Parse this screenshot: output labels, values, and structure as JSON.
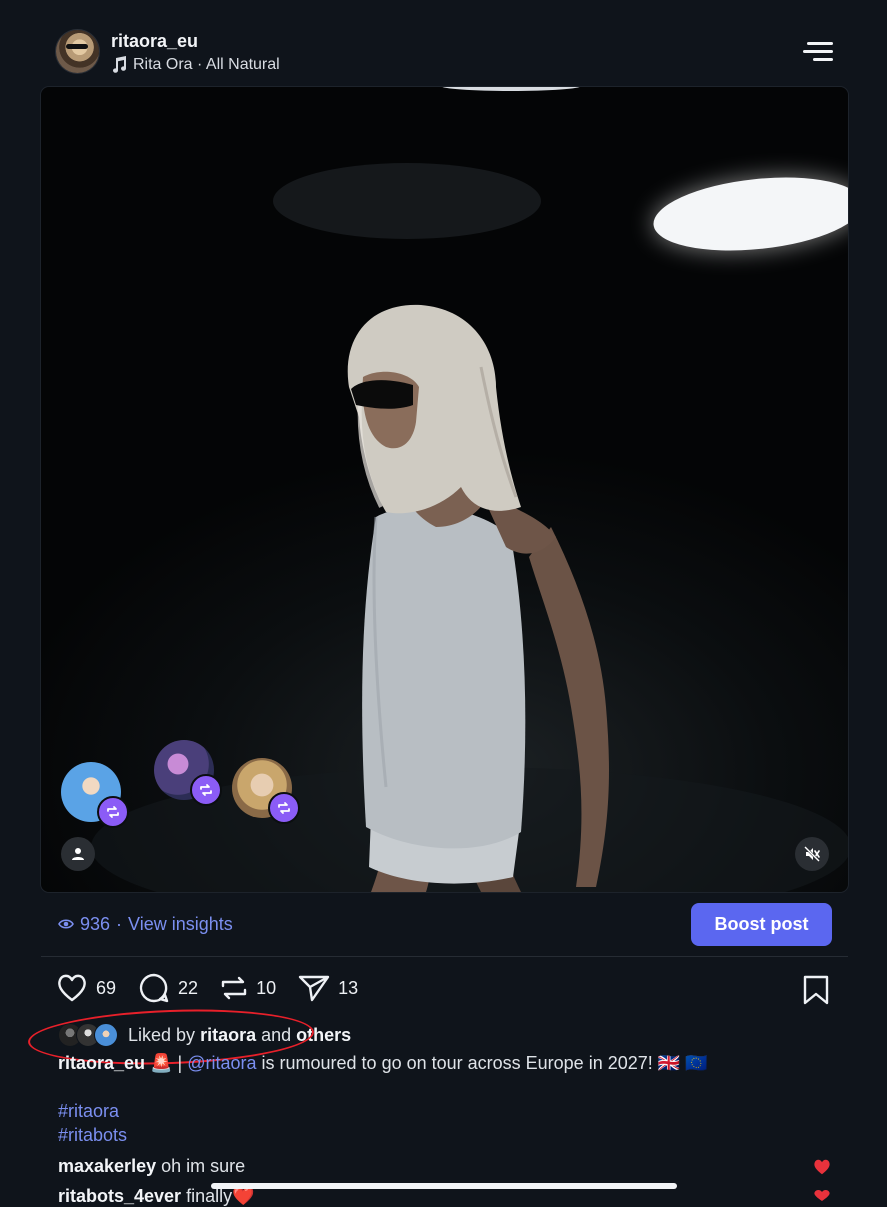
{
  "header": {
    "username": "ritaora_eu",
    "song": "Rita Ora · All Natural",
    "icons": {
      "music": "music-note-icon",
      "menu": "menu-icon"
    }
  },
  "media": {
    "reposter_icons": [
      "repost-icon"
    ],
    "user_tag_icon": "person-icon",
    "mute_icon": "speaker-muted-icon"
  },
  "insights": {
    "views": "936",
    "separator": "·",
    "link": "View insights",
    "boost_label": "Boost post"
  },
  "actions": {
    "likes": "69",
    "comments": "22",
    "reposts": "10",
    "shares": "13"
  },
  "liked_by": {
    "prefix": "Liked by",
    "user": "ritaora",
    "joiner": "and",
    "others": "others"
  },
  "caption": {
    "author": "ritaora_eu",
    "emoji": "🚨",
    "separator": "|",
    "mention": "@ritaora",
    "text": "is rumoured to go on tour across Europe in 2027!",
    "flags": "🇬🇧 🇪🇺"
  },
  "hashtags": [
    "#ritaora",
    "#ritabots"
  ],
  "comments": [
    {
      "author": "maxakerley",
      "text": "oh im sure"
    },
    {
      "author": "ritabots_4ever",
      "text": "finally❤️"
    }
  ],
  "colors": {
    "background": "#0f141b",
    "accent": "#5b67f0",
    "link": "#7b8ff0",
    "repost_badge": "#8b5cf6",
    "annotation": "#e8202a",
    "like_heart": "#e8323c"
  }
}
